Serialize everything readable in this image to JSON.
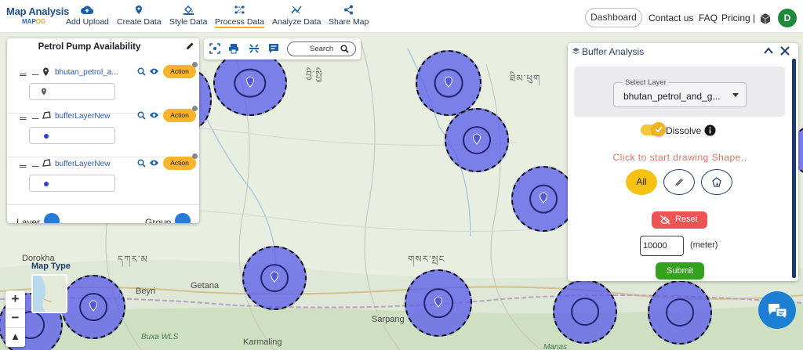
{
  "brand": {
    "title": "Map Analysis",
    "sub_map": "MAP",
    "sub_gis": "OG"
  },
  "nav": [
    {
      "label": "Add Upload",
      "icon": "cloud-upload-icon"
    },
    {
      "label": "Create Data",
      "icon": "map-pin-icon"
    },
    {
      "label": "Style Data",
      "icon": "paint-bucket-icon"
    },
    {
      "label": "Process Data",
      "icon": "process-nodes-icon",
      "active": true
    },
    {
      "label": "Analyze Data",
      "icon": "analyze-icon"
    },
    {
      "label": "Share Map",
      "icon": "share-icon"
    }
  ],
  "header_right": {
    "dashboard": "Dashboard",
    "contact": "Contact us",
    "faq": "FAQ",
    "pricing": "Pricing |",
    "avatar_initial": "D"
  },
  "layer_panel": {
    "title": "Petrol Pump Availability",
    "layers": [
      {
        "name": "bhutan_petrol_a...",
        "type_icon": "point-layer-icon",
        "legend": "pin"
      },
      {
        "name": "bufferLayerNew",
        "type_icon": "polygon-layer-icon",
        "legend": "dot"
      },
      {
        "name": "bufferLayerNew",
        "type_icon": "polygon-layer-icon",
        "legend": "dot"
      }
    ],
    "action_label": "Action",
    "footer_left": "Layer",
    "footer_right": "Group"
  },
  "map_toolbar": {
    "search_label": "Search"
  },
  "map_type": {
    "label": "Map Type"
  },
  "map_labels": {
    "dorokha": "Dorokha",
    "beyri": "Beyri",
    "getana": "Getana",
    "sarpang": "Sarpang",
    "karmaling": "Karmaling",
    "buxa": "Buxa WLS",
    "manas": "Manas",
    "tib1": "བྱི་སྤྱི",
    "tib2": "ཐིམ་ཕུག",
    "tib3": "དཀར་མ",
    "tib4": "གསར་སྤང"
  },
  "buffer_panel": {
    "title": "Buffer Analysis",
    "select_label": "Select Layer",
    "select_value": "bhutan_petrol_and_g...",
    "dissolve_label": "Dissolve",
    "dissolve_on": true,
    "draw_hint": "Click to start drawing Shape..",
    "all_label": "All",
    "reset_label": "Reset",
    "distance_value": "10000",
    "distance_unit": "(meter)",
    "submit_label": "Submit"
  },
  "colors": {
    "brand_blue": "#1f4f8f",
    "accent_yellow": "#f6c315",
    "buffer_fill": "#5c60eb",
    "reset_red": "#ef5454",
    "submit_green": "#34a21e"
  }
}
